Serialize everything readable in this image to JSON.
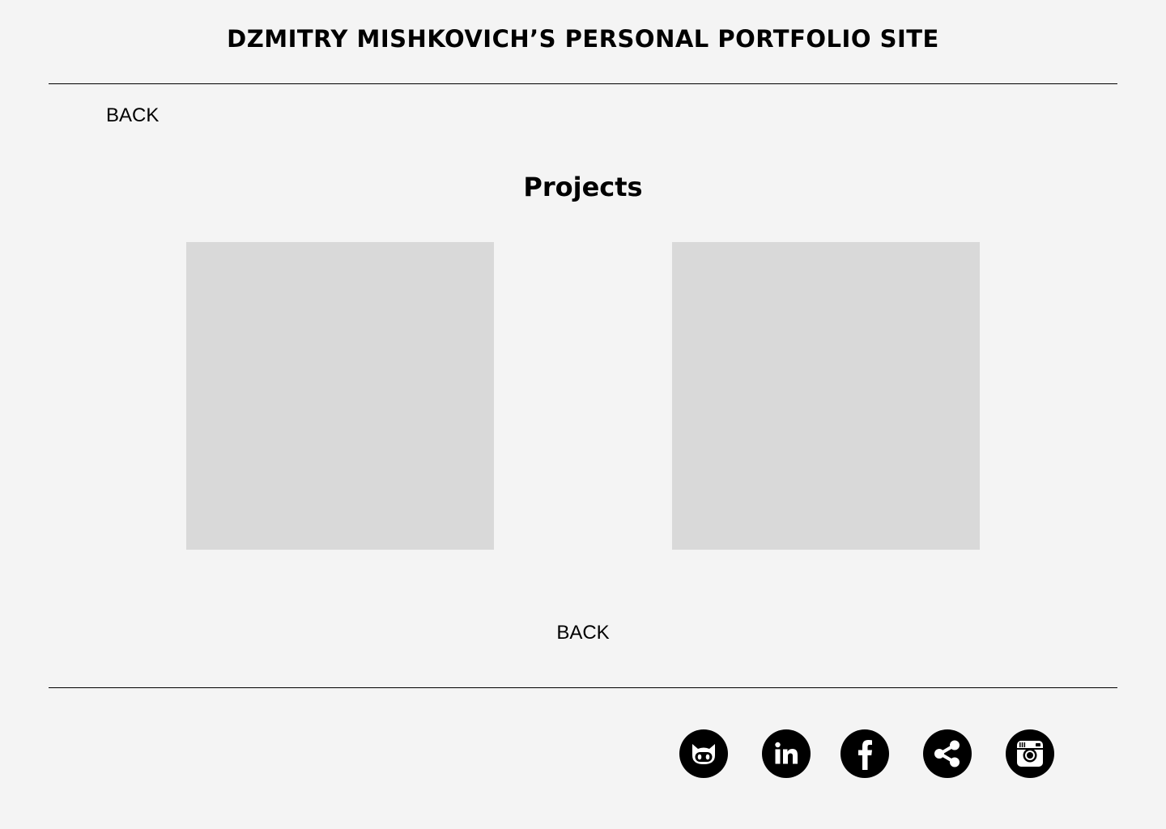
{
  "header": {
    "site_title": "DZMITRY MISHKOVICH’S PERSONAL PORTFOLIO SITE"
  },
  "nav": {
    "back_top_label": "BACK",
    "back_bottom_label": "BACK"
  },
  "main": {
    "section_title": "Projects",
    "projects": [
      {
        "placeholder_color": "#d9d9d9"
      },
      {
        "placeholder_color": "#d9d9d9"
      }
    ]
  },
  "footer": {
    "social_icons": [
      "github-icon",
      "linkedin-icon",
      "facebook-icon",
      "share-icon",
      "instagram-icon"
    ]
  },
  "colors": {
    "background": "#f4f4f4",
    "text": "#000000",
    "placeholder": "#d9d9d9"
  }
}
